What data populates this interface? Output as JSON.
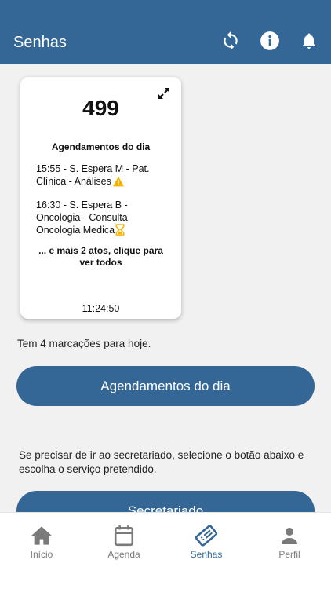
{
  "appbar": {
    "title": "Senhas",
    "icons": [
      "refresh-icon",
      "info-icon",
      "bell-icon"
    ]
  },
  "ticket": {
    "number": "499",
    "subtitle": "Agendamentos do dia",
    "appointments": [
      {
        "text": "15:55 - S. Espera M - Pat. Clínica - Análises",
        "status_icon": "warning-icon"
      },
      {
        "text": "16:30 - S. Espera B - Oncologia - Consulta Oncologia Medica",
        "status_icon": "hourglass-icon"
      }
    ],
    "more": "... e mais 2 atos, clique para ver todos",
    "time": "11:24:50"
  },
  "main": {
    "count_text": "Tem 4 marcações para hoje.",
    "agenda_button": "Agendamentos do dia",
    "help_text": "Se precisar de ir ao secretariado, selecione o botão abaixo e escolha o serviço pretendido.",
    "secretariado_button": "Secretariado"
  },
  "nav": {
    "items": [
      {
        "label": "Início",
        "icon": "home-icon"
      },
      {
        "label": "Agenda",
        "icon": "calendar-icon"
      },
      {
        "label": "Senhas",
        "icon": "ticket-icon",
        "active": true
      },
      {
        "label": "Perfil",
        "icon": "person-icon"
      }
    ]
  },
  "colors": {
    "primary": "#346796",
    "background": "#f1f1f1",
    "warning": "#f5b400",
    "inactive_nav": "#7a7a7a"
  }
}
